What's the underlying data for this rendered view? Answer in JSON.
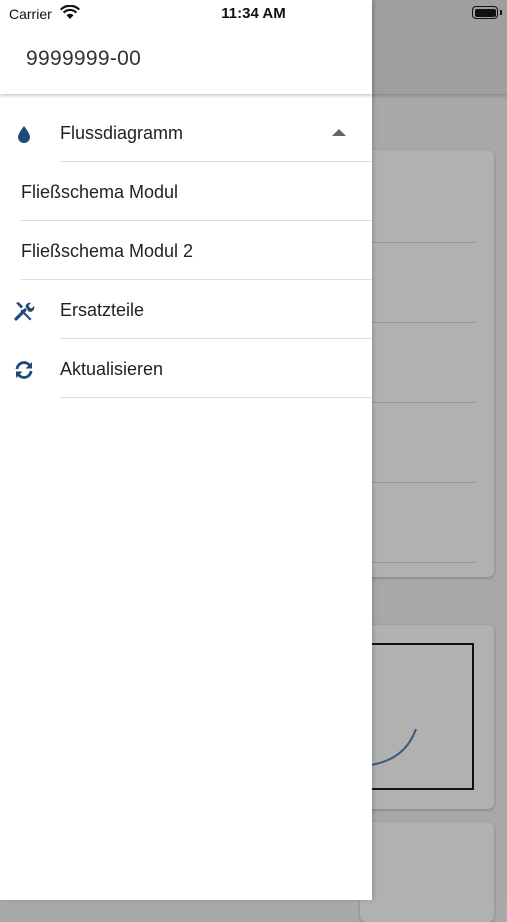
{
  "status_bar": {
    "carrier": "Carrier",
    "time": "11:34 AM"
  },
  "drawer": {
    "title": "9999999-00",
    "items": [
      {
        "label": "Flussdiagramm",
        "icon": "water-drop-icon",
        "expanded": true
      },
      {
        "label": "Fließschema Modul"
      },
      {
        "label": "Fließschema Modul 2"
      },
      {
        "label": "Ersatzteile",
        "icon": "tools-icon"
      },
      {
        "label": "Aktualisieren",
        "icon": "refresh-icon"
      }
    ]
  },
  "colors": {
    "accent": "#1d4a7a",
    "overlay": "#a8a8a8"
  }
}
